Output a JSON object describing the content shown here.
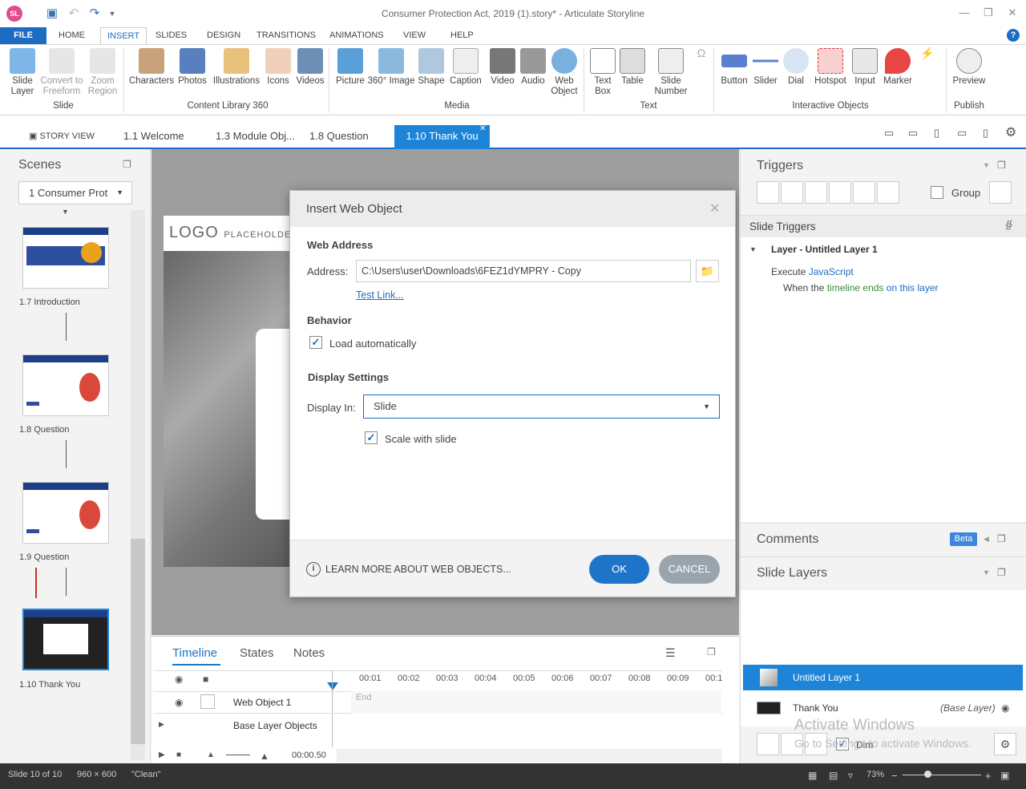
{
  "app": {
    "icon_text": "SL",
    "window_title": "Consumer Protection Act, 2019 (1).story* - Articulate Storyline"
  },
  "menu": [
    "FILE",
    "HOME",
    "INSERT",
    "SLIDES",
    "DESIGN",
    "TRANSITIONS",
    "ANIMATIONS",
    "VIEW",
    "HELP"
  ],
  "ribbon": {
    "slide_group": {
      "label": "Slide",
      "items": [
        "Slide Layer",
        "Convert to Freeform",
        "Zoom Region"
      ]
    },
    "content_library_group": {
      "label": "Content Library 360",
      "items": [
        "Characters",
        "Photos",
        "Illustrations",
        "Icons",
        "Videos"
      ]
    },
    "media_group": {
      "label": "Media",
      "items": [
        "Picture",
        "360° Image",
        "Shape",
        "Caption",
        "Video",
        "Audio",
        "Web Object"
      ]
    },
    "text_group": {
      "label": "Text",
      "items": [
        "Text Box",
        "Table",
        "Slide Number"
      ]
    },
    "interactive_group": {
      "label": "Interactive Objects",
      "items": [
        "Button",
        "Slider",
        "Dial",
        "Hotspot",
        "Input",
        "Marker"
      ]
    },
    "publish_group": {
      "label": "Publish",
      "items": [
        "Preview"
      ]
    }
  },
  "tabs": {
    "story_view": "STORY VIEW",
    "items": [
      "1.1 Welcome",
      "1.3 Module Obj...",
      "1.8 Question",
      "1.10 Thank You"
    ]
  },
  "scenes": {
    "title": "Scenes",
    "dropdown": "1 Consumer Prot",
    "slides": [
      "1.7 Introduction",
      "1.8 Question",
      "1.9 Question",
      "1.10 Thank You"
    ]
  },
  "canvas": {
    "logo": "LOGO",
    "logo_sub": "PLACEHOLDER"
  },
  "dialog": {
    "title": "Insert Web Object",
    "web_address_heading": "Web Address",
    "address_label": "Address:",
    "address_value": "C:\\Users\\user\\Downloads\\6FEZ1dYMPRY - Copy",
    "test_link": "Test Link...",
    "behavior_heading": "Behavior",
    "load_auto_label": "Load automatically",
    "display_heading": "Display Settings",
    "display_in_label": "Display In:",
    "display_in_value": "Slide",
    "scale_label": "Scale with slide",
    "learn_more": "LEARN MORE ABOUT WEB OBJECTS...",
    "ok": "OK",
    "cancel": "CANCEL"
  },
  "timeline": {
    "tabs": [
      "Timeline",
      "States",
      "Notes"
    ],
    "ticks": [
      "00:01",
      "00:02",
      "00:03",
      "00:04",
      "00:05",
      "00:06",
      "00:07",
      "00:08",
      "00:09",
      "00:1"
    ],
    "rows": [
      "Web Object 1",
      "Base Layer Objects"
    ],
    "end_label": "End",
    "time": "00:00.50"
  },
  "triggers": {
    "title": "Triggers",
    "group_label": "Group",
    "slide_triggers": "Slide Triggers",
    "layer_row": "Layer - Untitled Layer 1",
    "execute": "Execute",
    "javascript": "JavaScript",
    "when_the": "When the",
    "timeline_ends": "timeline ends",
    "on": "on",
    "this_layer": "this layer"
  },
  "comments": {
    "title": "Comments",
    "badge": "Beta"
  },
  "slide_layers": {
    "title": "Slide Layers",
    "layers": [
      {
        "name": "Untitled Layer 1",
        "note": ""
      },
      {
        "name": "Thank You",
        "note": "(Base Layer)"
      }
    ],
    "dim_label": "Dim",
    "watermark_line1": "Activate Windows",
    "watermark_line2": "Go to Settings to activate Windows."
  },
  "status": {
    "slide": "Slide 10 of 10",
    "size": "960 × 600",
    "theme": "\"Clean\"",
    "zoom": "73%"
  }
}
